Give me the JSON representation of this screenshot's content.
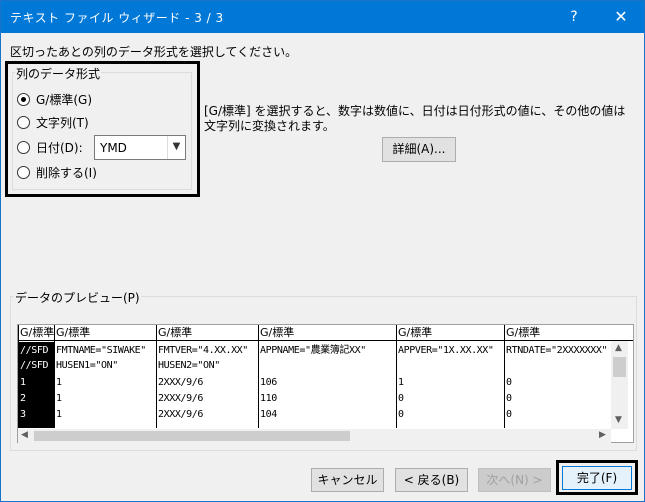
{
  "window": {
    "title": "テキスト ファイル ウィザード - 3 / 3",
    "help": "?",
    "close": "✕"
  },
  "instruction": "区切ったあとの列のデータ形式を選択してください。",
  "format_group": {
    "legend": "列のデータ形式",
    "options": [
      {
        "label": "G/標準(G)",
        "checked": true
      },
      {
        "label": "文字列(T)",
        "checked": false
      },
      {
        "label": "日付(D):",
        "checked": false
      },
      {
        "label": "削除する(I)",
        "checked": false
      }
    ],
    "date_format": "YMD"
  },
  "description": "[G/標準] を選択すると、数字は数値に、日付は日付形式の値に、その他の値は文字列に変換されます。",
  "advanced_button": "詳細(A)...",
  "preview": {
    "legend": "データのプレビュー(P)",
    "columns": [
      {
        "header": "G/標準",
        "cells": [
          "//SFD",
          "//SFD",
          "1",
          "2",
          "3"
        ]
      },
      {
        "header": "G/標準",
        "cells": [
          "FMTNAME=\"SIWAKE\"",
          "HUSEN1=\"ON\"",
          "1",
          "1",
          "1"
        ]
      },
      {
        "header": "G/標準",
        "cells": [
          "FMTVER=\"4.XX.XX\"",
          "HUSEN2=\"ON\"",
          "2XXX/9/6",
          "2XXX/9/6",
          "2XXX/9/6"
        ]
      },
      {
        "header": "G/標準",
        "cells": [
          "APPNAME=\"農業簿記XX\"",
          "",
          "106",
          "110",
          "104"
        ]
      },
      {
        "header": "G/標準",
        "cells": [
          "APPVER=\"1X.XX.XX\"",
          "",
          "1",
          "0",
          "0"
        ]
      },
      {
        "header": "G/標準",
        "cells": [
          "RTNDATE=\"2XXXXXXX\"",
          "",
          "0",
          "0",
          "0"
        ]
      }
    ]
  },
  "buttons": {
    "cancel": "キャンセル",
    "back": "< 戻る(B)",
    "next": "次へ(N) >",
    "finish": "完了(F)"
  }
}
